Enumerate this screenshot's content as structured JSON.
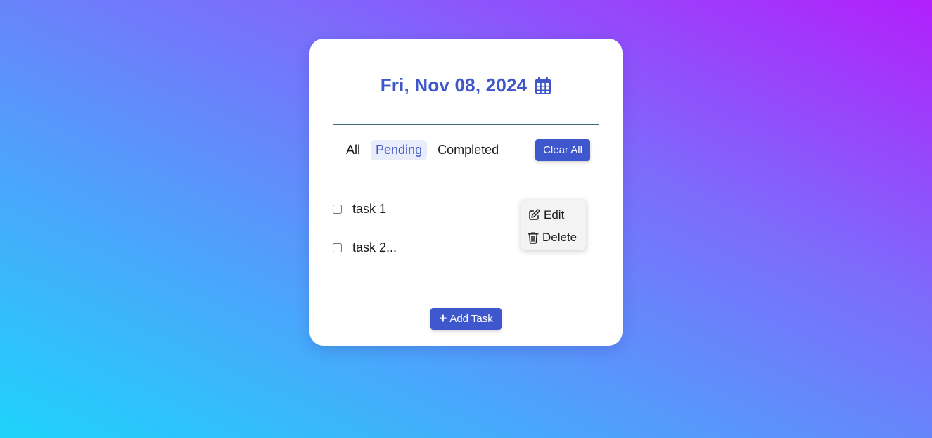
{
  "header": {
    "date": "Fri, Nov 08, 2024",
    "calendar_icon": "calendar-icon"
  },
  "filters": {
    "all": "All",
    "pending": "Pending",
    "completed": "Completed",
    "active": "pending"
  },
  "clear_all_label": "Clear All",
  "tasks": [
    {
      "text": "task 1",
      "checked": false
    },
    {
      "text": "task 2...",
      "checked": false
    }
  ],
  "context_menu": {
    "edit_label": "Edit",
    "delete_label": "Delete",
    "edit_icon": "edit-icon",
    "delete_icon": "trash-icon"
  },
  "add_task_label": "Add Task",
  "colors": {
    "accent": "#3f57cd",
    "gradient_start": "#1ed3fb",
    "gradient_end": "#b21ffb",
    "active_filter_bg": "#e8ecfb"
  }
}
